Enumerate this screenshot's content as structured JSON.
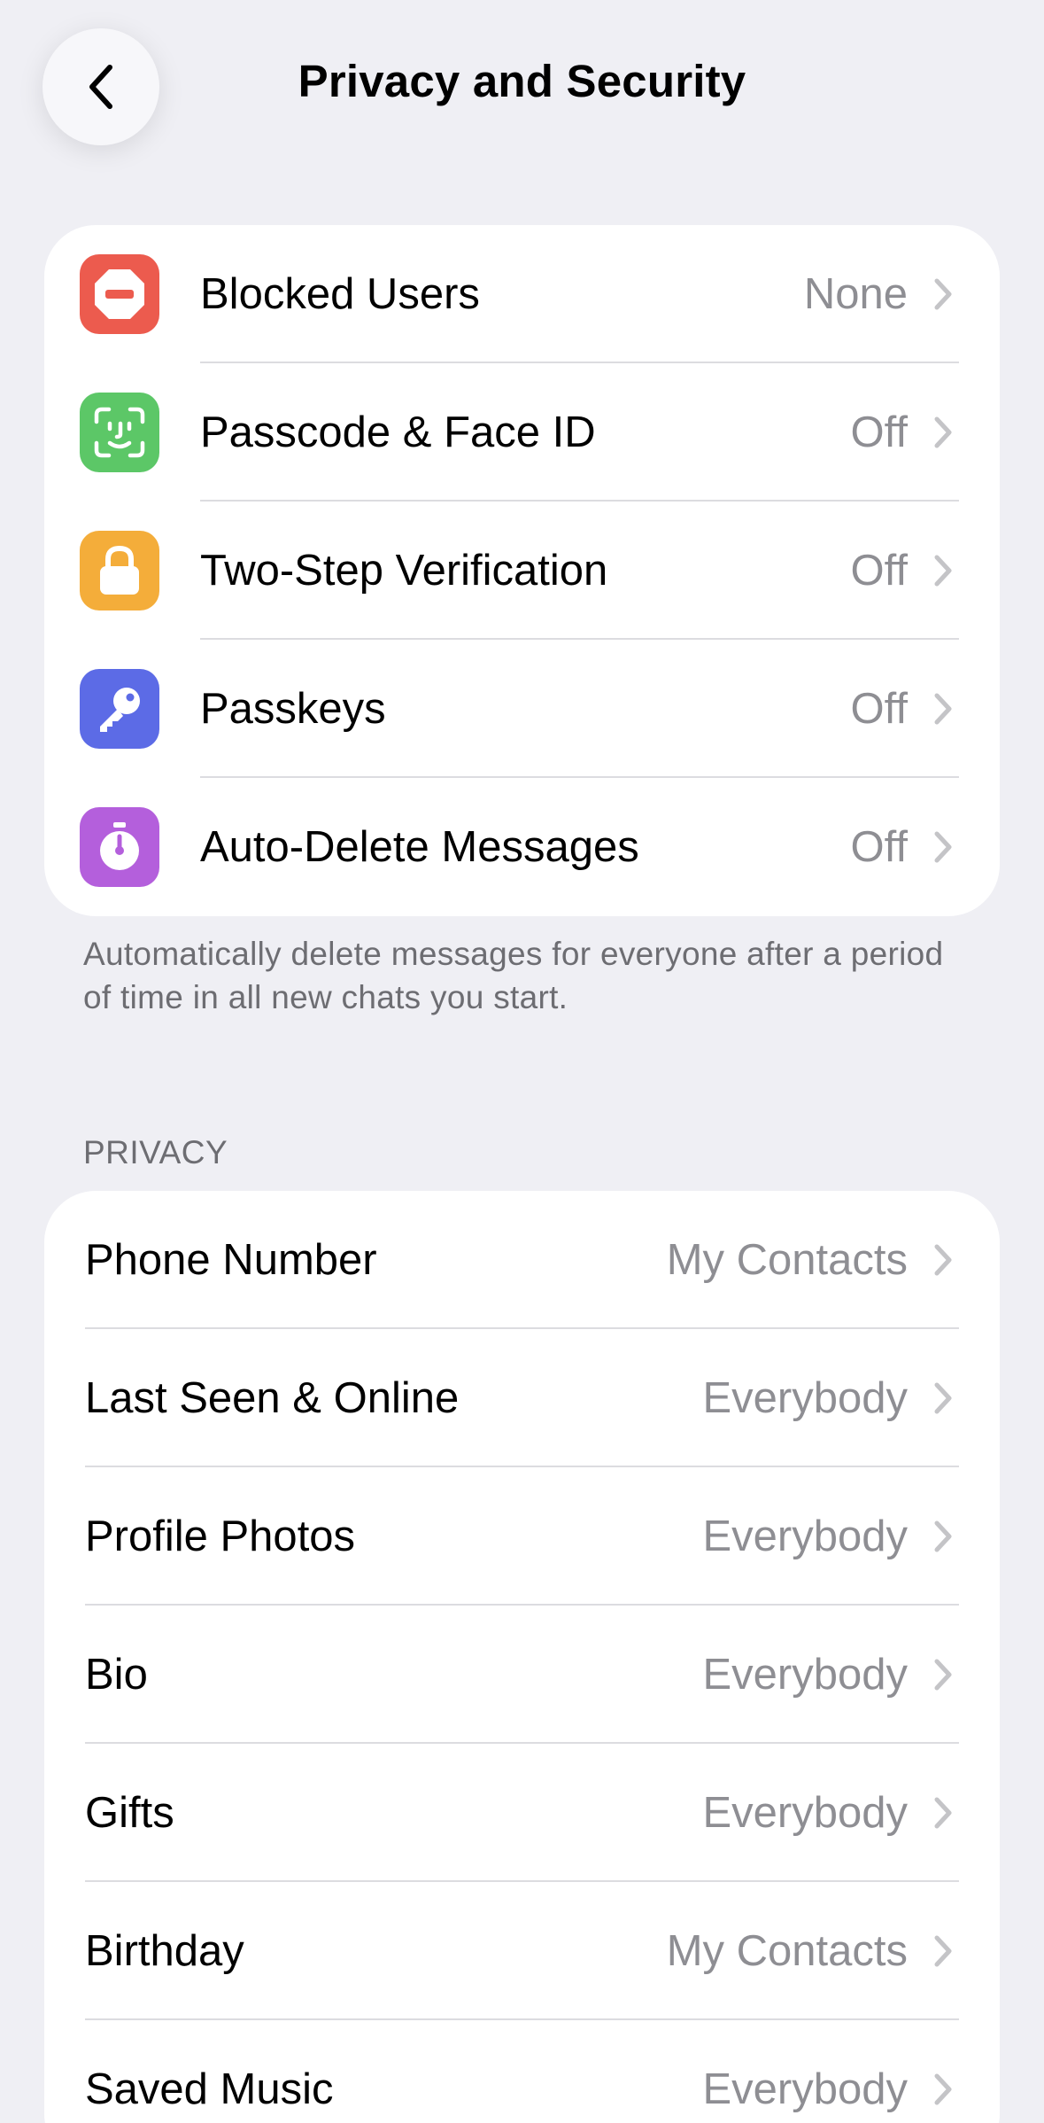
{
  "nav": {
    "title": "Privacy and Security",
    "back_icon": "chevron-left-icon"
  },
  "security_section": {
    "items": [
      {
        "label": "Blocked Users",
        "value": "None",
        "icon": "blocked-icon",
        "icon_color": "#ec5b4e"
      },
      {
        "label": "Passcode & Face ID",
        "value": "Off",
        "icon": "face-id-icon",
        "icon_color": "#5cc767"
      },
      {
        "label": "Two-Step Verification",
        "value": "Off",
        "icon": "lock-icon",
        "icon_color": "#f4ad3a"
      },
      {
        "label": "Passkeys",
        "value": "Off",
        "icon": "key-icon",
        "icon_color": "#5c6be6"
      },
      {
        "label": "Auto-Delete Messages",
        "value": "Off",
        "icon": "timer-icon",
        "icon_color": "#b45fdc"
      }
    ],
    "footer": "Automatically delete messages for everyone after a period of time in all new chats you start."
  },
  "privacy_section": {
    "header": "PRIVACY",
    "items": [
      {
        "label": "Phone Number",
        "value": "My Contacts"
      },
      {
        "label": "Last Seen & Online",
        "value": "Everybody"
      },
      {
        "label": "Profile Photos",
        "value": "Everybody"
      },
      {
        "label": "Bio",
        "value": "Everybody"
      },
      {
        "label": "Gifts",
        "value": "Everybody"
      },
      {
        "label": "Birthday",
        "value": "My Contacts"
      },
      {
        "label": "Saved Music",
        "value": "Everybody"
      }
    ]
  },
  "colors": {
    "background": "#efeff4",
    "card": "#ffffff",
    "secondary_text": "#8e8e93",
    "chevron": "#c4c4c7"
  }
}
